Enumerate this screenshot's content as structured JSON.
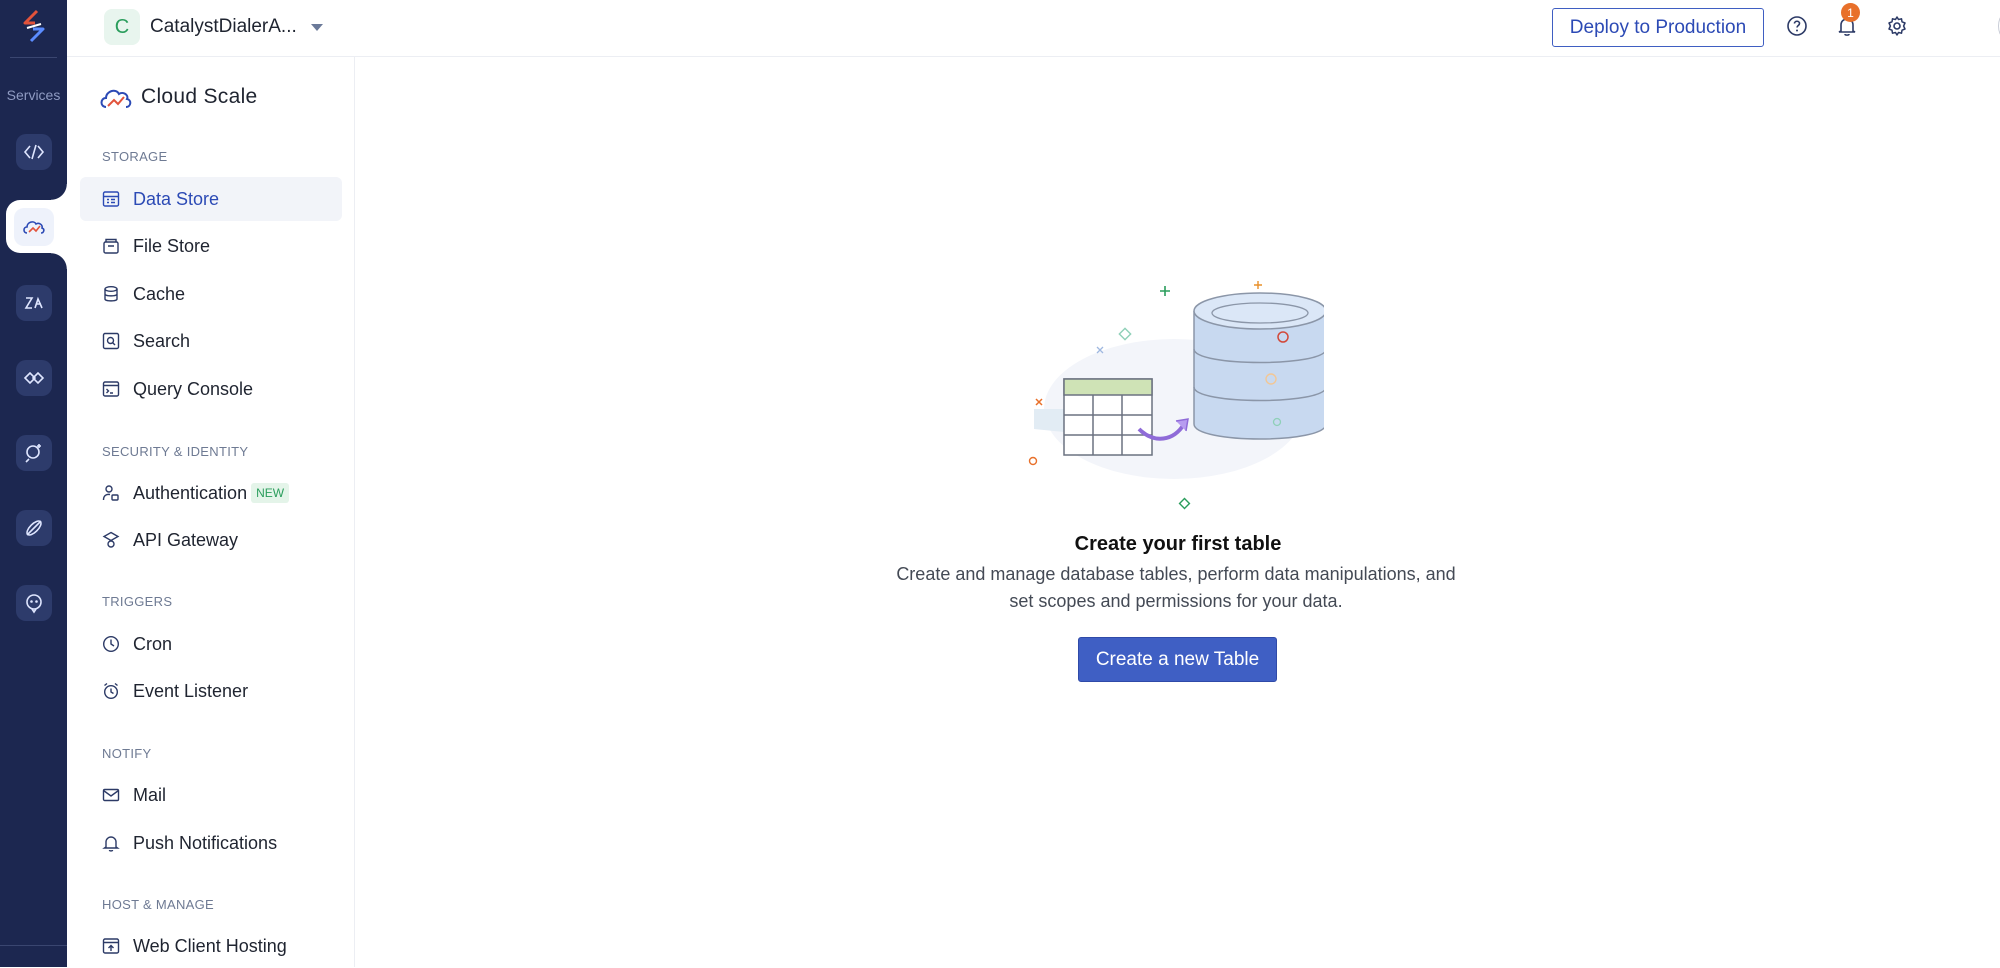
{
  "rail": {
    "services_label": "Services",
    "items": [
      {
        "icon": "code-icon"
      },
      {
        "icon": "cloud-scale-icon",
        "active": true
      },
      {
        "icon": "zia-icon"
      },
      {
        "icon": "integrations-icon"
      },
      {
        "icon": "ai-search-icon"
      },
      {
        "icon": "rocket-icon"
      },
      {
        "icon": "bot-icon"
      }
    ]
  },
  "topbar": {
    "project_initial": "C",
    "project_name": "CatalystDialerA...",
    "deploy_label": "Deploy to Production",
    "notification_count": "1"
  },
  "sidebar": {
    "brand_title": "Cloud Scale",
    "sections": {
      "storage": "STORAGE",
      "security": "SECURITY & IDENTITY",
      "triggers": "TRIGGERS",
      "notify": "NOTIFY",
      "host": "HOST & MANAGE"
    },
    "items": {
      "data_store": "Data Store",
      "file_store": "File Store",
      "cache": "Cache",
      "search": "Search",
      "query_console": "Query Console",
      "authentication": "Authentication",
      "new_tag": "NEW",
      "api_gateway": "API Gateway",
      "cron": "Cron",
      "event_listener": "Event Listener",
      "mail": "Mail",
      "push_notifications": "Push Notifications",
      "web_client_hosting": "Web Client Hosting"
    }
  },
  "main": {
    "title": "Create your first table",
    "description": "Create and manage database tables, perform data manipulations, and set scopes and permissions for your data.",
    "create_label": "Create a new Table"
  },
  "colors": {
    "rail_bg": "#1c2750",
    "accent": "#3f5fc4",
    "notification": "#e8702a",
    "new_tag": "#2a9d5c"
  }
}
